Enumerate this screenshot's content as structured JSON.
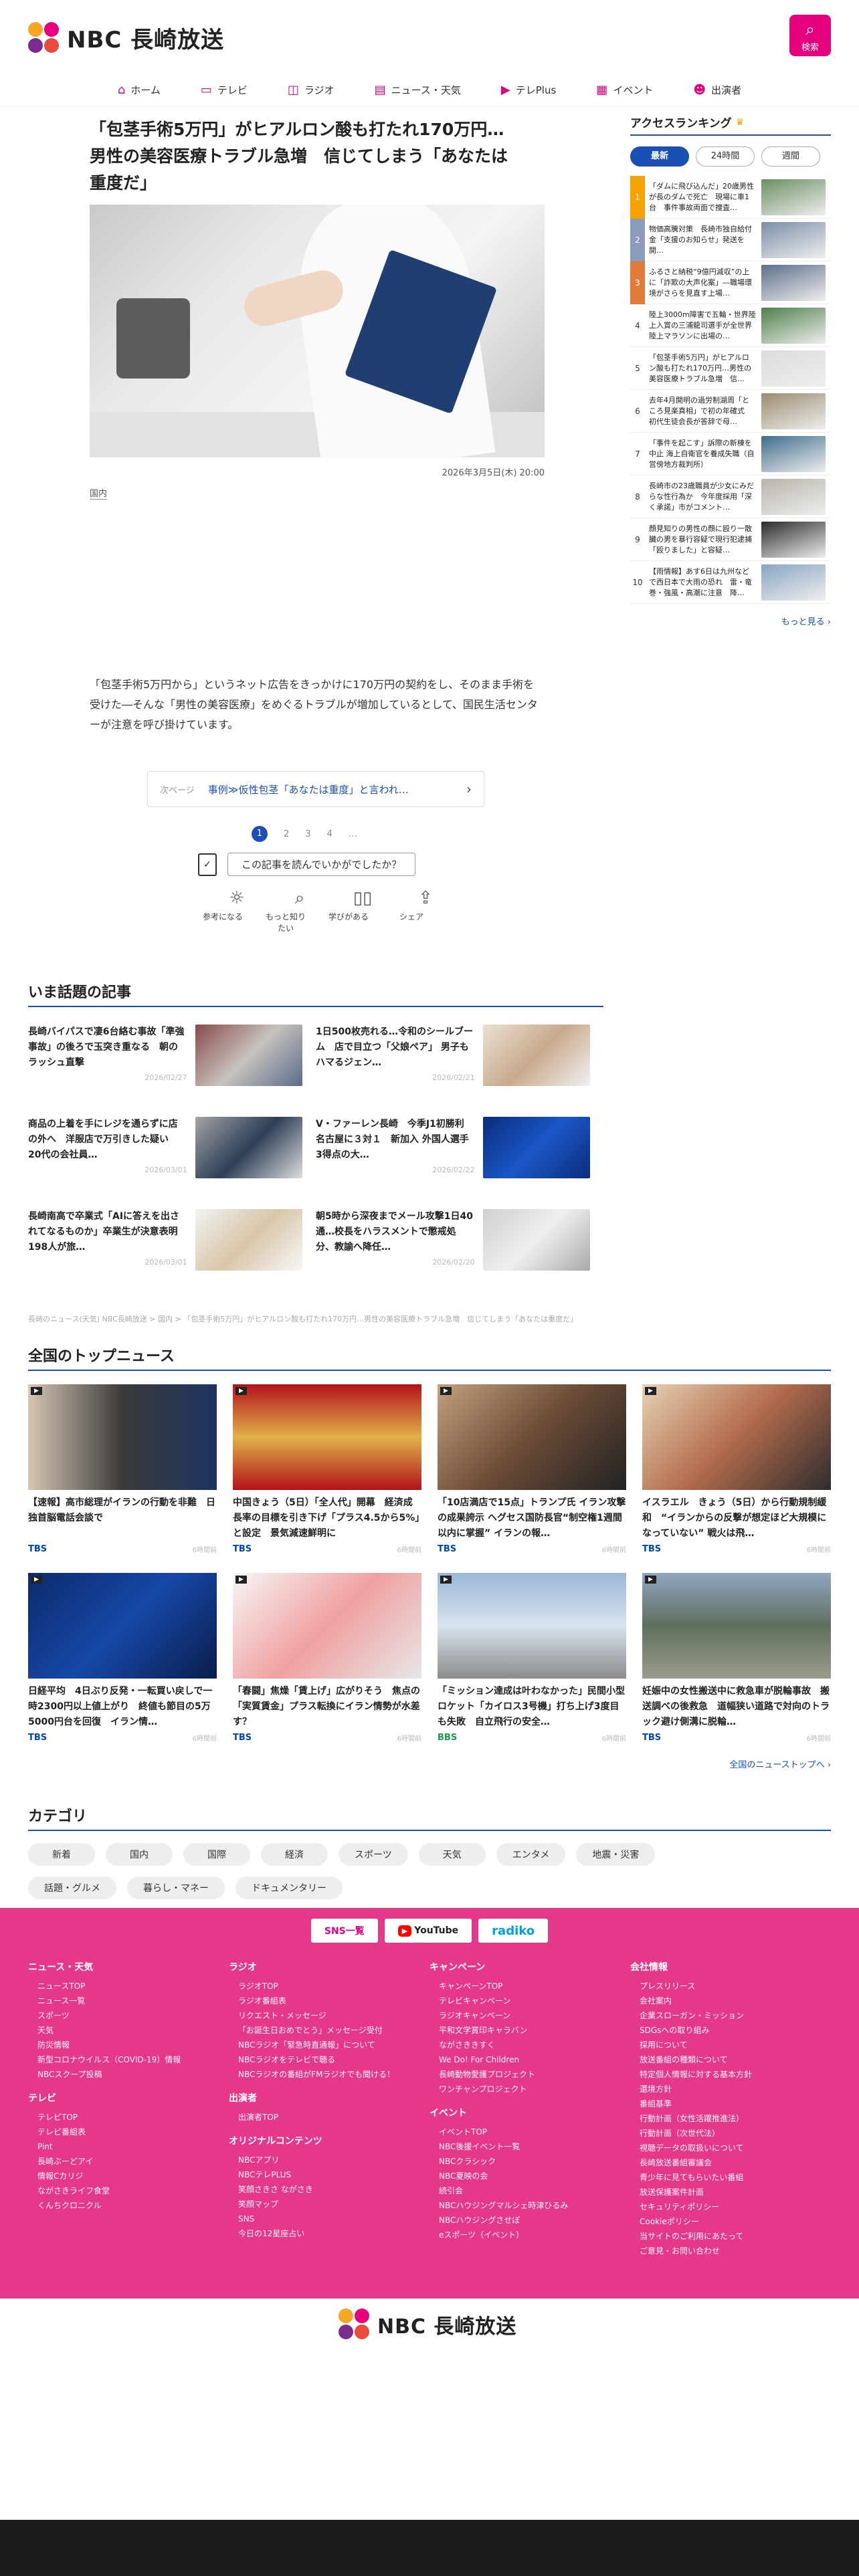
{
  "brand": {
    "name": "NBC 長崎放送"
  },
  "header": {
    "search_label": "検索"
  },
  "nav": [
    {
      "icon": "home-icon",
      "label": "ホーム"
    },
    {
      "icon": "tv-icon",
      "label": "テレビ"
    },
    {
      "icon": "radio-icon",
      "label": "ラジオ"
    },
    {
      "icon": "news-icon",
      "label": "ニュース・天気"
    },
    {
      "icon": "play-icon",
      "label": "テレPlus"
    },
    {
      "icon": "calendar-icon",
      "label": "イベント"
    },
    {
      "icon": "people-icon",
      "label": "出演者"
    }
  ],
  "article": {
    "title": "「包茎手術5万円」がヒアルロン酸も打たれ170万円…男性の美容医療トラブル急増　信じてしまう「あなたは重度だ」",
    "date": "2026年3月5日(木) 20:00",
    "category": "国内",
    "lead": "「包茎手術5万円から」というネット広告をきっかけに170万円の契約をし、そのまま手術を受けた―そんな「男性の美容医療」をめぐるトラブルが増加しているとして、国民生活センターが注意を呼び掛けています。",
    "next_label": "次ページ",
    "next_title": "事例≫仮性包茎「あなたは重度」と言われ…",
    "pages": [
      "1",
      "2",
      "3",
      "4",
      "…"
    ],
    "feedback_q": "この記事を読んでいかがでしたか？",
    "reactions": [
      {
        "icon": "bulb-icon",
        "label": "参考になる"
      },
      {
        "icon": "magnifier-icon",
        "label": "もっと知りたい"
      },
      {
        "icon": "book-icon",
        "label": "学びがある"
      },
      {
        "icon": "share-icon",
        "label": "シェア"
      }
    ]
  },
  "ranking": {
    "title": "アクセスランキング",
    "tabs": [
      "最新",
      "24時間",
      "週間"
    ],
    "items": [
      {
        "n": "1",
        "text": "「ダムに飛び込んだ」20歳男性が長のダムで死亡　現場に車1台　事件事故両面で捜査…",
        "color": "#f4a300"
      },
      {
        "n": "2",
        "text": "物価高騰対策　長崎市独自給付金「支援のお知らせ」発送を開…",
        "color": "#8a9bbd"
      },
      {
        "n": "3",
        "text": "ふるさと納税“9億円減収”の上に「詐欺の大声化案」―職場環境がさらを見直す上場…",
        "color": "#e07b39"
      },
      {
        "n": "4",
        "text": "陸上3000m障害で五輪・世界陸上入賞の三浦龍司選手が全世界陸上マラソンに出場の…",
        "color": ""
      },
      {
        "n": "5",
        "text": "「包茎手術5万円」がヒアルロン酸も打たれ170万円…男性の美容医療トラブル急増　信…",
        "color": ""
      },
      {
        "n": "6",
        "text": "去年4月開明の過労制湖周「ところ見楽真相」で初の年確式　初代生徒会長が答辞で母…",
        "color": ""
      },
      {
        "n": "7",
        "text": "「事件を起こす」訴際の新棟を中止 海上自衛官を養成失職（自営傍地方裁判所）",
        "color": ""
      },
      {
        "n": "8",
        "text": "長崎市の23歳職員が少女にみだらな性行為か　今年度採用「深く承諾」市がコメント…",
        "color": ""
      },
      {
        "n": "9",
        "text": "顔見知りの男性の顔に殴り一散臓の男を暴行容疑で現行犯逮捕「殴りました」と容疑…",
        "color": ""
      },
      {
        "n": "10",
        "text": "【雨情報】あす6日は九州などで西日本で大雨の恐れ　雷・竜巻・強風・高潮に注意　降…",
        "color": ""
      }
    ],
    "more": "もっと見る ›"
  },
  "topics": {
    "title": "いま話題の記事",
    "items": [
      {
        "title": "長崎バイパスで凄6台絡む事故「準強事故」の後ろで玉突き重なる　朝のラッシュ直撃",
        "date": "2026/02/27"
      },
      {
        "title": "1日500枚売れる…令和のシールブーム　店で目立つ「父娘ペア」 男子もハマるジェン…",
        "date": "2026/02/21"
      },
      {
        "title": "商品の上着を手にレジを通らずに店の外へ　洋服店で万引きした疑い　20代の会社員…",
        "date": "2026/03/01"
      },
      {
        "title": "V・ファーレン長崎　今季J1初勝利　名古屋に３対１　新加入 外国人選手3得点の大…",
        "date": "2026/02/22"
      },
      {
        "title": "長崎南高で卒業式「AIに答えを出されてなるものか」卒業生が決意表明　198人が旅…",
        "date": "2026/03/01"
      },
      {
        "title": "朝5時から深夜までメール攻撃1日40通…校長をハラスメントで懲戒処分、教諭へ降任…",
        "date": "2026/02/20"
      }
    ]
  },
  "breadcrumb": "長崎のニュース(天気) NBC長崎放送 > 国内 > 「包茎手術5万円」がヒアルロン酸も打たれ170万円…男性の美容医療トラブル急増　信じてしまう「あなたは重度だ」",
  "zenkoku": {
    "title": "全国のトップニュース",
    "items": [
      {
        "title": "【速報】高市総理がイランの行動を非難　日独首脳電話会談で",
        "src": "TBS",
        "ago": "6時間前"
      },
      {
        "title": "中国きょう（5日）「全人代」開幕　経済成長率の目標を引き下げ「プラス4.5から5%」と設定　景気減速鮮明に",
        "src": "TBS",
        "ago": "6時間前"
      },
      {
        "title": "「10店満店で15点」トランプ氏 イラン攻撃の成果誇示 ヘグセス国防長官“制空権1週間以内に掌握” イランの報…",
        "src": "TBS",
        "ago": "6時間前"
      },
      {
        "title": "イスラエル　きょう（5日）から行動規制緩和　“イランからの反撃が想定ほど大規模になっていない” 戦火は飛…",
        "src": "TBS",
        "ago": "6時間前"
      },
      {
        "title": "日経平均　4日ぶり反発・一転買い戻しで一時2300円以上値上がり　終値も節目の5万5000円台を回復　イラン情…",
        "src": "TBS",
        "ago": "6時間前"
      },
      {
        "title": "「春闘」焦燥「賃上げ」広がりそう　焦点の「実質賃金」プラス転換にイラン情勢が水差す？",
        "src": "TBS",
        "ago": "6時間前"
      },
      {
        "title": "「ミッション達成は叶わなかった」民間小型ロケット「カイロス3号機」打ち上げ3度目も失敗　自立飛行の安全…",
        "src": "BBS",
        "ago": "6時間前"
      },
      {
        "title": "妊娠中の女性搬送中に救急車が脱輪事故　搬送調べの後救急　道幅狭い道路で対向のトラック避け側溝に脱輪…",
        "src": "TBS",
        "ago": "6時間前"
      }
    ],
    "more": "全国のニューストップへ ›"
  },
  "categories": {
    "title": "カテゴリ",
    "items": [
      "新着",
      "国内",
      "国際",
      "経済",
      "スポーツ",
      "天気",
      "エンタメ",
      "地震・災害",
      "話題・グルメ",
      "暮らし・マネー",
      "ドキュメンタリー"
    ]
  },
  "footer": {
    "sns": [
      "SNS一覧",
      "YouTube",
      "radiko"
    ],
    "cols": [
      [
        {
          "h": "ニュース・天気",
          "items": [
            "ニュースTOP",
            "ニュース一覧",
            "スポーツ",
            "天気",
            "防災情報",
            "新型コロナウイルス（COVID-19）情報",
            "NBCスクープ投稿"
          ]
        },
        {
          "h": "テレビ",
          "items": [
            "テレビTOP",
            "テレビ番組表",
            "Pint",
            "長崎ぶーどアイ",
            "情報Cカリジ",
            "ながさきライフ食堂",
            "くんちクロニクル"
          ]
        }
      ],
      [
        {
          "h": "ラジオ",
          "items": [
            "ラジオTOP",
            "ラジオ番組表",
            "リクエスト・メッセージ",
            "「お誕生日おめでとう」メッセージ受付",
            "NBCラジオ「緊急時直通報」について",
            "NBCラジオをテレビで聴る",
            "NBCラジオの番組がFMラジオでも聞ける！"
          ]
        },
        {
          "h": "出演者",
          "items": [
            "出演者TOP"
          ]
        },
        {
          "h": "オリジナルコンテンツ",
          "items": [
            "NBCアプリ",
            "NBCテレPLUS",
            "笑顔さきさ ながさき",
            "笑顔マップ",
            "SNS",
            "今日の12星座占い"
          ]
        }
      ],
      [
        {
          "h": "キャンペーン",
          "items": [
            "キャンペーンTOP",
            "テレビキャンペーン",
            "ラジオキャンペーン",
            "平和文学賞印キャラバン",
            "ながさききすく",
            "We Do! For Children",
            "長崎動物愛護プロジェクト",
            "ワンチャンプロジェクト"
          ]
        },
        {
          "h": "イベント",
          "items": [
            "イベントTOP",
            "NBC後援イベント一覧",
            "NBCクラシック",
            "NBC夏映の会",
            "続引会",
            "NBCハウジングマルシェ時津ひるみ",
            "NBCハウジングさせぼ",
            "eスポーツ（イベント）"
          ]
        }
      ],
      [
        {
          "h": "会社情報",
          "items": [
            "プレスリリース",
            "会社案内",
            "企業スローガン・ミッション",
            "SDGsへの取り組み",
            "採用について",
            "放送番組の種類について",
            "特定個人情報に対する基本方針",
            "還境方針",
            "番組基準",
            "行動計画（女性活躍推進法）",
            "行動計画（次世代法）",
            "視聴データの取扱いについて",
            "長崎放送番組審議会",
            "青少年に見てもらいたい番組",
            "放送保護案件計画",
            "セキュリティポリシー",
            "Cookieポリシー",
            "当サイトのご利用にあたって",
            "ご意見・お問い合わせ"
          ]
        }
      ]
    ]
  }
}
